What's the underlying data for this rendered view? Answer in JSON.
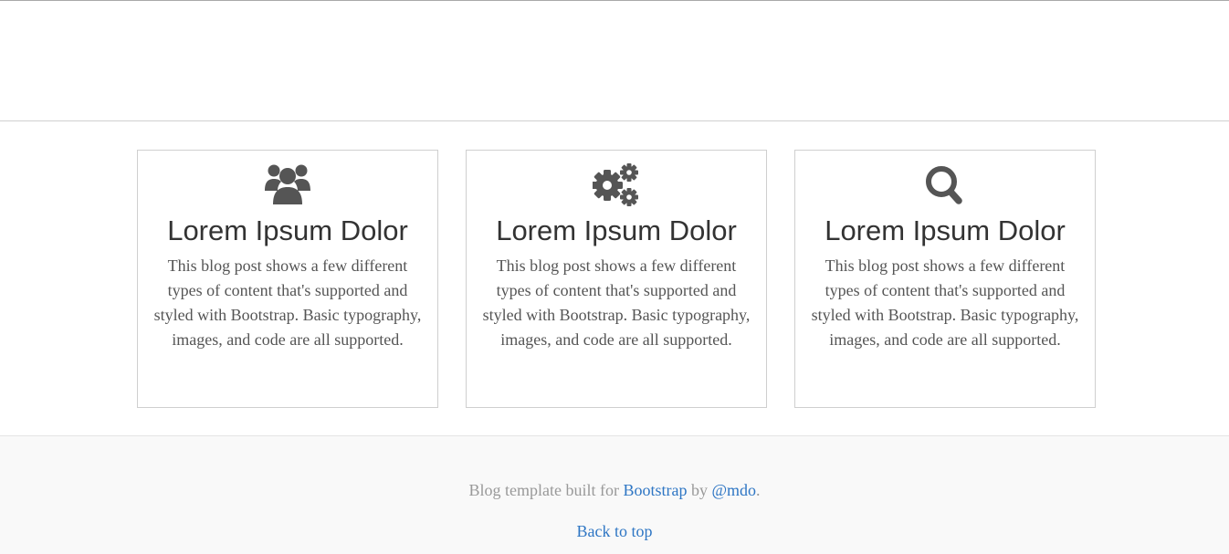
{
  "colors": {
    "link": "#2e76c4",
    "heading": "#333333",
    "body_text": "#555555",
    "muted_text": "#999999",
    "icon": "#555555",
    "footer_bg": "#f9f9f9"
  },
  "features": [
    {
      "icon": "users-icon",
      "title": "Lorem Ipsum Dolor",
      "body": "This blog post shows a few different types of content that's supported and styled with Bootstrap. Basic typography, images, and code are all supported."
    },
    {
      "icon": "gears-icon",
      "title": "Lorem Ipsum Dolor",
      "body": "This blog post shows a few different types of content that's supported and styled with Bootstrap. Basic typography, images, and code are all supported."
    },
    {
      "icon": "search-icon",
      "title": "Lorem Ipsum Dolor",
      "body": "This blog post shows a few different types of content that's supported and styled with Bootstrap. Basic typography, images, and code are all supported."
    }
  ],
  "footer": {
    "credits_prefix": "Blog template built for ",
    "bootstrap_link": "Bootstrap",
    "credits_by": " by ",
    "author_link": "@mdo",
    "credits_suffix": ".",
    "back_to_top": "Back to top"
  }
}
